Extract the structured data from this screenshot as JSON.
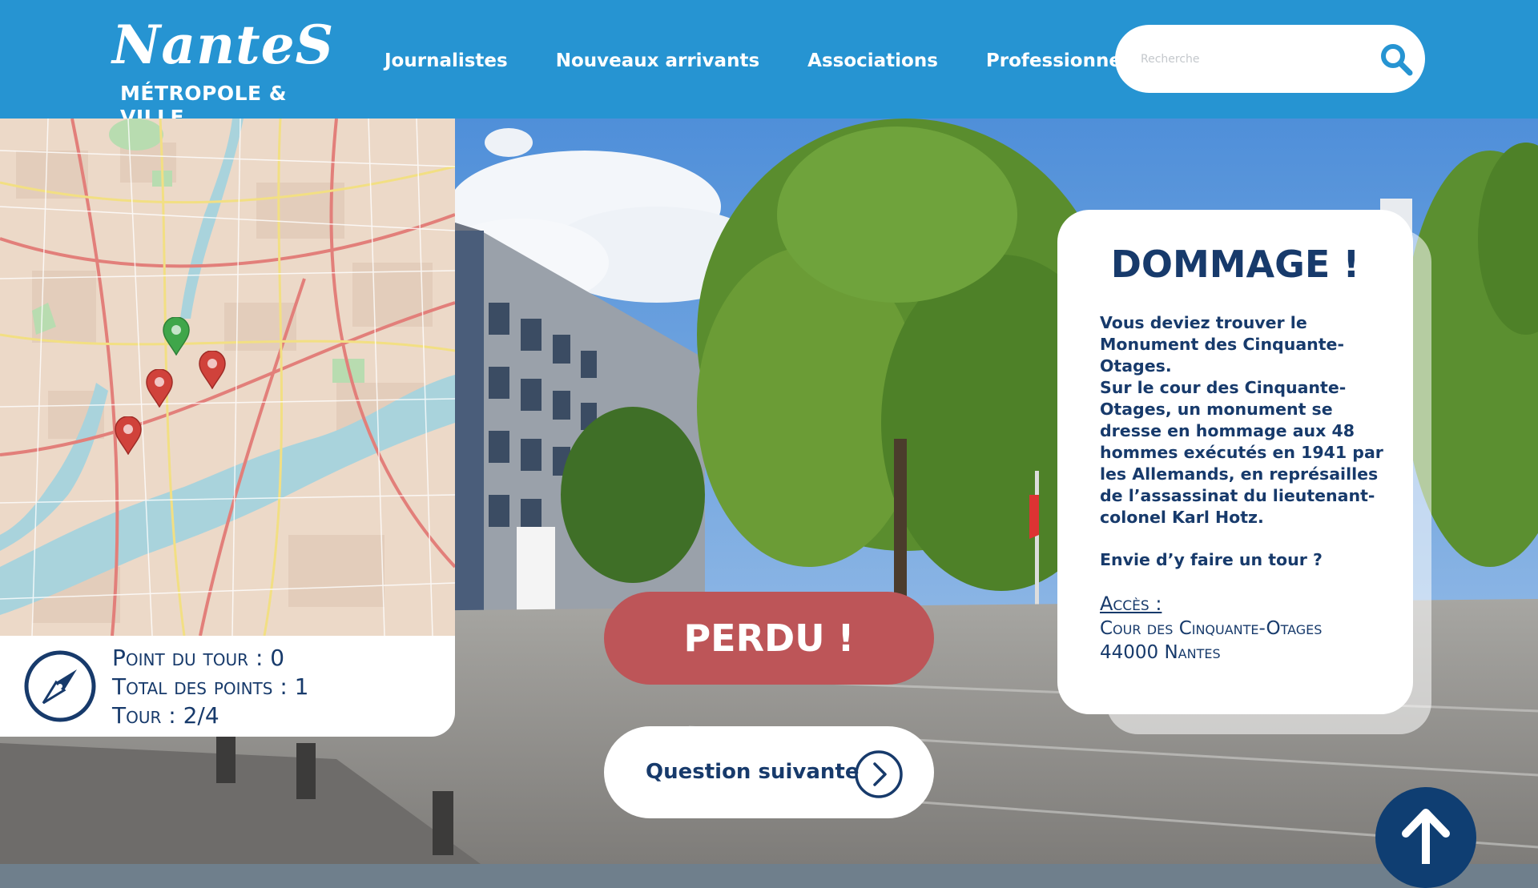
{
  "header": {
    "logo_word": "NanteS",
    "logo_sub": "MÉTROPOLE & VILLE",
    "nav": [
      "Journalistes",
      "Nouveaux arrivants",
      "Associations",
      "Professionnels"
    ],
    "search_placeholder": "Recherche"
  },
  "score": {
    "point_du_tour": "Point du tour : 0",
    "total_points": "Total des points : 1",
    "tour": "Tour : 2/4"
  },
  "lost_button": "PERDU !",
  "next_button": "Question suivante",
  "panel": {
    "title": "DOMMAGE !",
    "paragraph1": "Vous deviez trouver le Monument des Cinquante-Otages.",
    "paragraph2": "Sur le cour des Cinquante-Otages, un monument se dresse en hommage aux 48 hommes exécutés en 1941 par les Allemands, en représailles de l’assassinat du lieutenant-colonel Karl Hotz.",
    "paragraph3": "Envie d’y faire un tour ?",
    "access_label": "Accès :",
    "access_street": "Cour des Cinquante-Otages",
    "access_city": "44000 Nantes"
  },
  "colors": {
    "header_blue": "#2694d2",
    "navy": "#173a6b",
    "lost_red": "#bd5558",
    "pin_green": "#3fa64a",
    "pin_red": "#d0423b",
    "scroll_top": "#0f3e72"
  },
  "icons": {
    "search": "search-icon",
    "compass": "compass-icon",
    "next": "chevron-right-circle-icon",
    "scroll_top": "arrow-up-icon",
    "pins": [
      "map-pin-green-icon",
      "map-pin-red-icon",
      "map-pin-red-icon",
      "map-pin-red-icon"
    ]
  }
}
